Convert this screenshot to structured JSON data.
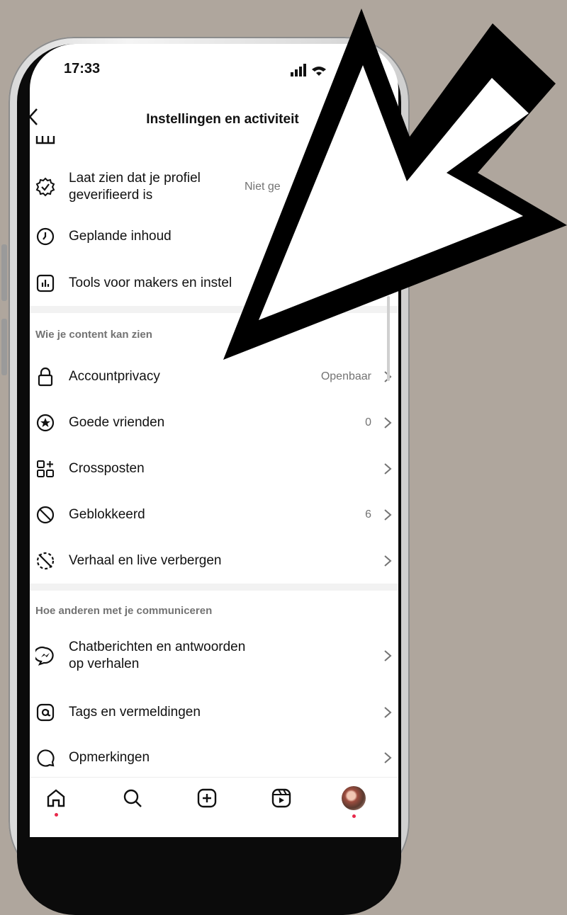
{
  "status_bar": {
    "time": "17:33"
  },
  "header": {
    "title": "Instellingen en activiteit"
  },
  "rows_top": [
    {
      "label_line1": "Laat zien dat je profiel",
      "label_line2": "geverifieerd is",
      "value": "Niet ge"
    },
    {
      "label": "Geplande inhoud"
    },
    {
      "label": "Tools voor makers en instel"
    }
  ],
  "section_visibility": {
    "heading": "Wie je content kan zien",
    "items": [
      {
        "label": "Accountprivacy",
        "value": "Openbaar",
        "icon": "lock-icon"
      },
      {
        "label": "Goede vrienden",
        "value": "0",
        "icon": "star-circle-icon"
      },
      {
        "label": "Crossposten",
        "value": "",
        "icon": "grid-plus-icon"
      },
      {
        "label": "Geblokkeerd",
        "value": "6",
        "icon": "block-icon"
      },
      {
        "label": "Verhaal en live verbergen",
        "value": "",
        "icon": "story-hide-icon"
      }
    ]
  },
  "section_interaction": {
    "heading": "Hoe anderen met je communiceren",
    "items": [
      {
        "label_line1": "Chatberichten en antwoorden",
        "label_line2": "op verhalen",
        "icon": "messenger-icon"
      },
      {
        "label": "Tags en vermeldingen",
        "icon": "at-icon"
      },
      {
        "label": "Opmerkingen",
        "icon": "comment-icon"
      }
    ]
  },
  "bottom_nav": [
    "home-icon",
    "search-icon",
    "create-icon",
    "reels-icon",
    "profile-avatar"
  ],
  "colors": {
    "background": "#afa69d",
    "notification_dot": "#e8294b",
    "secondary_text": "#737373"
  }
}
